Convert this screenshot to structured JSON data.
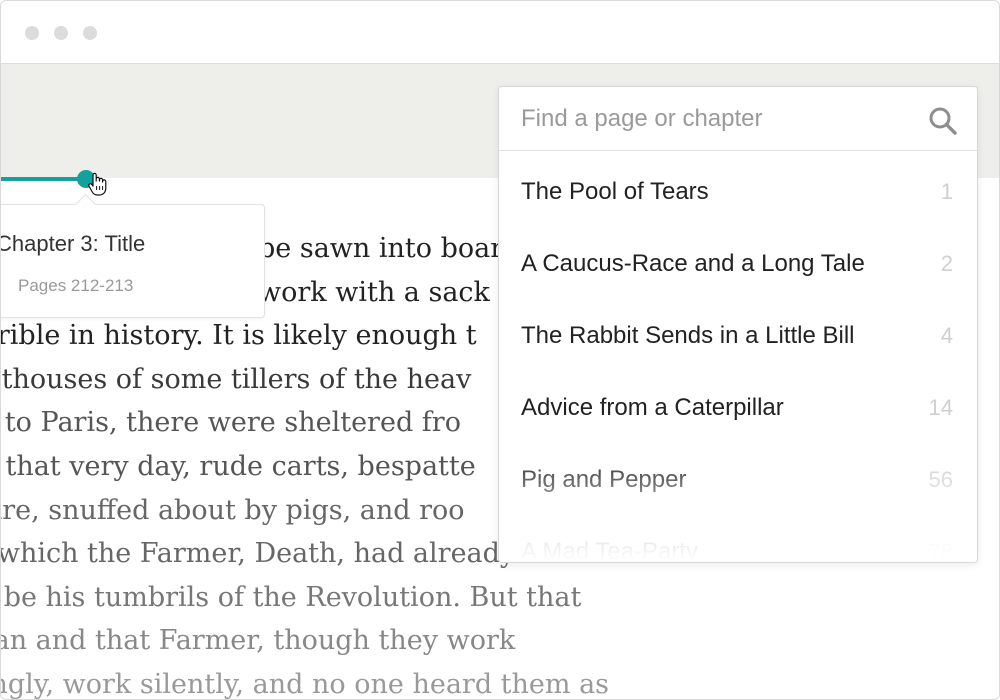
{
  "window": {
    "controls": [
      "close-dot",
      "minimize-dot",
      "maximize-dot"
    ]
  },
  "reader": {
    "progress_color": "#14a19c",
    "lines": [
      "be sawn into boar",
      "work with a sack a",
      "errible in history. It is likely enough t",
      "outhouses of some tillers of the heav",
      "nt to Paris, there were sheltered fro",
      "er that very day, rude carts, bespatte",
      "mire, snuffed about by pigs, and roo",
      "y, which the Farmer, Death, had already set",
      "to be his tumbrils of the Revolution. But that",
      "man and that Farmer, though they work",
      "singly, work silently, and no one heard them as"
    ]
  },
  "chapter_tooltip": {
    "title": "Chapter 3: Title",
    "pages": "Pages 212-213"
  },
  "search": {
    "placeholder": "Find a page or chapter",
    "value": "",
    "icon": "search-icon",
    "results": [
      {
        "title": "The Pool of Tears",
        "page": "1"
      },
      {
        "title": "A Caucus-Race and a Long Tale",
        "page": "2"
      },
      {
        "title": "The Rabbit Sends in a Little Bill",
        "page": "4"
      },
      {
        "title": "Advice from a Caterpillar",
        "page": "14"
      },
      {
        "title": "Pig and Pepper",
        "page": "56"
      },
      {
        "title": "A Mad Tea-Party",
        "page": "78"
      }
    ]
  }
}
